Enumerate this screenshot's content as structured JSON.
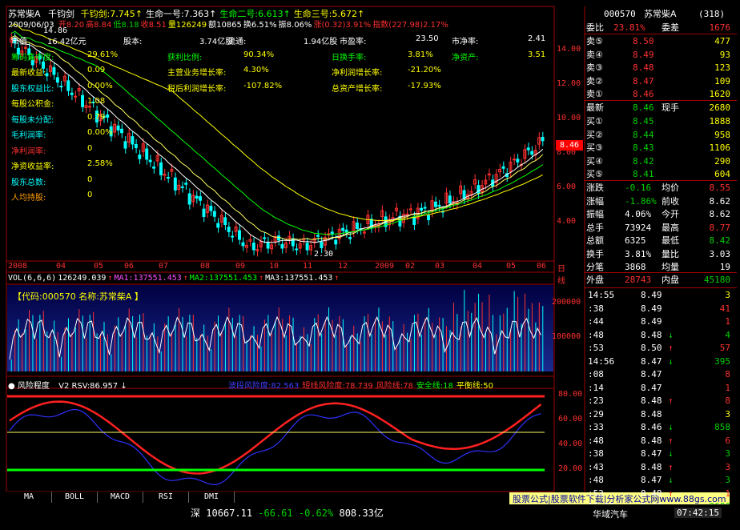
{
  "header": {
    "stock_name": "苏常柴A",
    "indicator_name": "千钧剑",
    "values_line1": [
      {
        "label": "千钧剑:",
        "value": "7.745",
        "arrow": "↑",
        "color": "#ffff00"
      },
      {
        "label": "生命一号:",
        "value": "7.363",
        "arrow": "↑",
        "color": "#ffffff"
      },
      {
        "label": "生命二号:",
        "value": "6.613",
        "arrow": "↑",
        "color": "#00ff00"
      },
      {
        "label": "生命三号:",
        "value": "5.672",
        "arrow": "↑",
        "color": "#ffff00"
      }
    ],
    "date": "2009/06/03",
    "ohlc_line": [
      {
        "label": "开",
        "value": "8.20",
        "color": "#ff3030"
      },
      {
        "label": "高",
        "value": "8.84",
        "color": "#ff3030"
      },
      {
        "label": "低",
        "value": "8.18",
        "color": "#00d000"
      },
      {
        "label": "收",
        "value": "8.51",
        "color": "#ff3030"
      },
      {
        "label": "量",
        "value": "126249",
        "color": "#ffff00"
      },
      {
        "label": "额",
        "value": "10865",
        "color": "#ffffff"
      },
      {
        "label": "换",
        "value": "6.51%",
        "color": "#ffffff"
      },
      {
        "label": "振",
        "value": "8.06%",
        "color": "#ffffff"
      },
      {
        "label": "涨",
        "value": "(0.32)3.91%",
        "color": "#ff3030"
      },
      {
        "label": "指数",
        "value": "(227.98)2.17%",
        "color": "#ff3030"
      }
    ]
  },
  "fundamentals": {
    "rows": [
      [
        {
          "label": "市值",
          "value": "16.42亿元",
          "lc": "#ffffff"
        },
        {
          "label": "股本:",
          "value": "3.74亿股",
          "lc": "#ffffff"
        },
        {
          "label": "流通:",
          "value": "1.94亿股",
          "lc": "#ffffff"
        },
        {
          "label": "市盈率:",
          "value": "23.50",
          "lc": "#ffffff"
        },
        {
          "label": "市净率:",
          "value": "2.41",
          "lc": "#ffffff"
        }
      ],
      [
        {
          "label": "筹码集中度:",
          "value": "29.61%",
          "lc": "#00ff00"
        },
        {
          "label": "获利比例:",
          "value": "90.34%",
          "lc": "#00ff00"
        },
        {
          "label": "日换手率:",
          "value": "3.81%",
          "lc": "#00ff00"
        },
        {
          "label": "净资产:",
          "value": "3.51",
          "lc": "#00ff00"
        }
      ],
      [
        {
          "label": "最新收益:",
          "value": "0.09",
          "lc": "#ffff00"
        },
        {
          "label": "主营业务增长率:",
          "value": "4.30%",
          "lc": "#ffff00"
        },
        {
          "label": "净利润增长率:",
          "value": "-21.20%",
          "lc": "#ffff00"
        }
      ],
      [
        {
          "label": "股东权益比:",
          "value": "0.00%",
          "lc": "#00ffff"
        },
        {
          "label": "税后利润增长率:",
          "value": "-107.82%",
          "lc": "#ffff00"
        },
        {
          "label": "总资产增长率:",
          "value": "-17.93%",
          "lc": "#ffff00"
        }
      ],
      [
        {
          "label": "每股公积金:",
          "value": "1.08",
          "lc": "#ffff00"
        }
      ],
      [
        {
          "label": "每股未分配:",
          "value": "0.79",
          "lc": "#00ffff"
        }
      ],
      [
        {
          "label": "毛利润率:",
          "value": "0.00%",
          "lc": "#00ffff"
        }
      ],
      [
        {
          "label": "净利润率:",
          "value": "0",
          "lc": "#ff3030"
        }
      ],
      [
        {
          "label": "净资收益率:",
          "value": "2.58%",
          "lc": "#ffff00"
        }
      ],
      [
        {
          "label": "股东总数:",
          "value": "0",
          "lc": "#00ffff"
        }
      ],
      [
        {
          "label": "人均持股:",
          "value": "0",
          "lc": "#ff9c00"
        }
      ]
    ]
  },
  "price_chart": {
    "y_ticks": [
      "14.00",
      "12.00",
      "10.00",
      "8.00",
      "6.00",
      "4.00"
    ],
    "current_price_label": "8.46",
    "low_label": "2.30",
    "high_label": "14.86",
    "annotations": [
      "短",
      "头",
      "短",
      "头",
      "短",
      "头",
      "短",
      "头",
      "短",
      "头",
      "短",
      "头"
    ],
    "x_ticks": [
      "2008",
      "04",
      "05",
      "06",
      "07",
      "08",
      "09",
      "10",
      "11",
      "12",
      "2009",
      "02",
      "03",
      "04",
      "05",
      "06"
    ],
    "x_axis_right": "日线"
  },
  "volume": {
    "title_line": [
      {
        "text": "VOL(6,6,6)",
        "color": "#ffffff"
      },
      {
        "text": "126249.039",
        "color": "#ffffff"
      },
      {
        "text": "↑",
        "color": "#ff3030"
      },
      {
        "text": "MA1:137551.453",
        "color": "#ff50ff"
      },
      {
        "text": "↑",
        "color": "#ff3030"
      },
      {
        "text": "MA2:137551.453",
        "color": "#00ff00"
      },
      {
        "text": "↑",
        "color": "#ff3030"
      },
      {
        "text": "MA3:137551.453",
        "color": "#ffffff"
      },
      {
        "text": "↑",
        "color": "#ff3030"
      }
    ],
    "code_label": "【代码:000570 名称:苏常柴A 】",
    "y_ticks": [
      "200000",
      "100000"
    ]
  },
  "risk": {
    "title": "风险程度",
    "v2": "V2 RSV:86.957",
    "legend": [
      {
        "text": "波段风险度:82.563",
        "color": "#4040ff"
      },
      {
        "text": "短线风险度:78.739",
        "color": "#ff3030"
      },
      {
        "text": "风险线:78",
        "color": "#ff3030"
      },
      {
        "text": "安全线:18",
        "color": "#00ff00"
      },
      {
        "text": "平衡线:50",
        "color": "#ffff00"
      }
    ],
    "y_ticks": [
      "80.00",
      "60.00",
      "40.00",
      "20.00"
    ]
  },
  "tabs": [
    "MA",
    "BOLL",
    "MACD",
    "RSI",
    "DMI"
  ],
  "right_panel": {
    "code": "000570",
    "name": "苏常柴A",
    "count": "(318)",
    "weibi_label": "委比",
    "weibi_value": "23.81%",
    "weicha_label": "委差",
    "weicha_value": "1676",
    "sells": [
      {
        "label": "卖⑤",
        "price": "8.50",
        "vol": "477"
      },
      {
        "label": "卖④",
        "price": "8.49",
        "vol": "93"
      },
      {
        "label": "卖③",
        "price": "8.48",
        "vol": "123"
      },
      {
        "label": "卖②",
        "price": "8.47",
        "vol": "109"
      },
      {
        "label": "卖①",
        "price": "8.46",
        "vol": "1620"
      }
    ],
    "latest": {
      "label": "最新",
      "value": "8.46",
      "label2": "现手",
      "value2": "2680"
    },
    "buys": [
      {
        "label": "买①",
        "price": "8.45",
        "vol": "1888"
      },
      {
        "label": "买②",
        "price": "8.44",
        "vol": "958"
      },
      {
        "label": "买③",
        "price": "8.43",
        "vol": "1106"
      },
      {
        "label": "买④",
        "price": "8.42",
        "vol": "290"
      },
      {
        "label": "买⑤",
        "price": "8.41",
        "vol": "604"
      }
    ],
    "stats": [
      {
        "l1": "涨跌",
        "v1": "-0.16",
        "c1": "#00d000",
        "l2": "均价",
        "v2": "8.55",
        "c2": "#ff3030"
      },
      {
        "l1": "涨幅",
        "v1": "-1.86%",
        "c1": "#00d000",
        "l2": "前收",
        "v2": "8.62",
        "c2": "#ffffff"
      },
      {
        "l1": "振幅",
        "v1": "4.06%",
        "c1": "#ffffff",
        "l2": "今开",
        "v2": "8.62",
        "c2": "#ffffff"
      },
      {
        "l1": "总手",
        "v1": "73924",
        "c1": "#ffffff",
        "l2": "最高",
        "v2": "8.77",
        "c2": "#ff3030"
      },
      {
        "l1": "总额",
        "v1": "6325",
        "c1": "#ffffff",
        "l2": "最低",
        "v2": "8.42",
        "c2": "#00d000"
      },
      {
        "l1": "换手",
        "v1": "3.81%",
        "c1": "#ffffff",
        "l2": "量比",
        "v2": "3.03",
        "c2": "#ffffff"
      },
      {
        "l1": "分笔",
        "v1": "3868",
        "c1": "#ffffff",
        "l2": "均量",
        "v2": "19",
        "c2": "#ffffff"
      }
    ],
    "outer": {
      "l1": "外盘",
      "v1": "28743",
      "l2": "内盘",
      "v2": "45180"
    },
    "ticks": [
      {
        "time": "14:55",
        "price": "8.49",
        "arrow": "",
        "vol": "3",
        "vc": "#ffff00"
      },
      {
        "time": ":38",
        "price": "8.49",
        "arrow": "",
        "vol": "41",
        "vc": "#ff3030"
      },
      {
        "time": ":44",
        "price": "8.49",
        "arrow": "",
        "vol": "1",
        "vc": "#ff3030"
      },
      {
        "time": ":48",
        "price": "8.48",
        "arrow": "↓",
        "vol": "4",
        "vc": "#00d000"
      },
      {
        "time": ":53",
        "price": "8.50",
        "arrow": "↑",
        "vol": "57",
        "vc": "#ff3030"
      },
      {
        "time": "14:56",
        "price": "8.47",
        "arrow": "↓",
        "vol": "395",
        "vc": "#00d000"
      },
      {
        "time": ":08",
        "price": "8.47",
        "arrow": "",
        "vol": "8",
        "vc": "#ff3030"
      },
      {
        "time": ":14",
        "price": "8.47",
        "arrow": "",
        "vol": "1",
        "vc": "#ff3030"
      },
      {
        "time": ":23",
        "price": "8.48",
        "arrow": "↑",
        "vol": "8",
        "vc": "#ff3030"
      },
      {
        "time": ":29",
        "price": "8.48",
        "arrow": "",
        "vol": "3",
        "vc": "#ffff00"
      },
      {
        "time": ":33",
        "price": "8.46",
        "arrow": "↓",
        "vol": "858",
        "vc": "#00d000"
      },
      {
        "time": ":48",
        "price": "8.48",
        "arrow": "↑",
        "vol": "6",
        "vc": "#ff3030"
      },
      {
        "time": ":38",
        "price": "8.47",
        "arrow": "↓",
        "vol": "3",
        "vc": "#00d000"
      },
      {
        "time": ":43",
        "price": "8.48",
        "arrow": "↑",
        "vol": "3",
        "vc": "#ff3030"
      },
      {
        "time": ":48",
        "price": "8.47",
        "arrow": "↓",
        "vol": "3",
        "vc": "#00d000"
      },
      {
        "time": ":53",
        "price": "8.48",
        "arrow": "↑",
        "vol": "1",
        "vc": "#ff3030"
      },
      {
        "time": "15:00",
        "price": "8.46",
        "arrow": "↓",
        "vol": "2680",
        "vc": "#00d000"
      }
    ]
  },
  "bottom": {
    "index_name": "深",
    "index_value": "10667.11",
    "index_change": "-66.61",
    "index_pct": "-0.62%",
    "index_amount": "808.33亿",
    "stock": "华域汽车",
    "time": "07:42:15"
  },
  "watermark": "股票公式|股票软件下载|分析家公式网www.88gs.com"
}
